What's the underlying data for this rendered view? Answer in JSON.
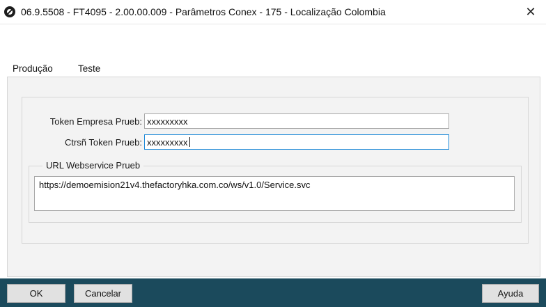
{
  "window": {
    "title": "06.9.5508 - FT4095 - 2.00.00.009 - Parâmetros Conex - 175 - Localização Colombia",
    "close_glyph": "✕"
  },
  "tabs": [
    {
      "label": "Produção",
      "selected": false
    },
    {
      "label": "Teste",
      "selected": true
    }
  ],
  "fields": {
    "token_empresa": {
      "label": "Token Empresa Prueb:",
      "value": "xxxxxxxxx"
    },
    "ctrsn_token": {
      "label": "Ctrsñ Token Prueb:",
      "value": "xxxxxxxxx"
    }
  },
  "url_group": {
    "legend": "URL Webservice Prueb",
    "value": "https://demoemision21v4.thefactoryhka.com.co/ws/v1.0/Service.svc"
  },
  "buttons": {
    "ok": "OK",
    "cancel": "Cancelar",
    "help": "Ayuda"
  },
  "colors": {
    "tab_accent": "#1ea1d8",
    "bottom_bar": "#1b4a5c",
    "focus_border": "#1f8ad8"
  }
}
